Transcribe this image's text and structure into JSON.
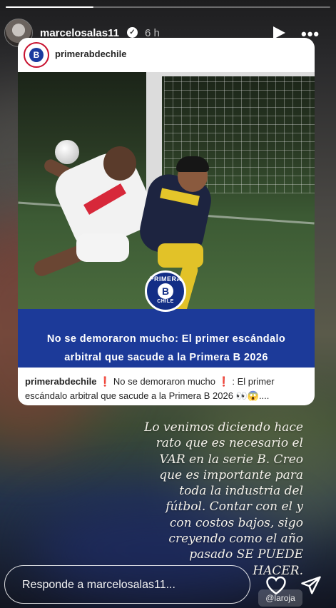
{
  "story": {
    "progress": 0.27,
    "username": "marcelosalas11",
    "time": "6 h",
    "icons": {
      "verified": "verified-badge-icon",
      "play": "play-icon",
      "more": "more-options-icon"
    }
  },
  "post": {
    "account": "primerabdechile",
    "logo_text": "B",
    "badge": {
      "top": "PRIMERA",
      "letter": "B",
      "bottom": "CHILE"
    },
    "headline_line1": "No se demoraron mucho: El primer escándalo",
    "headline_line2": "arbitral que sacude a la Primera B 2026",
    "caption_user": "primerabdechile",
    "caption_part1": "No se demoraron mucho",
    "caption_part2": ": El primer escándalo arbitral que sacude a la Primera B 2026 👀😱...."
  },
  "overlay": {
    "lines": [
      "Lo venimos diciendo hace",
      "rato que es necesario el",
      "VAR en la serie B.  Creo",
      "que es importante para",
      "toda la industria del",
      "fútbol.  Contar con el y",
      "con costos bajos, sigo",
      "creyendo como el año",
      "pasado SE PUEDE",
      "HACER."
    ],
    "mention": "@laroja"
  },
  "reply": {
    "placeholder": "Responde a marcelosalas11...",
    "icons": {
      "like": "heart-icon",
      "send": "send-icon"
    }
  },
  "colors": {
    "banner": "#1c3a99",
    "accent_red": "#d21f1f"
  }
}
